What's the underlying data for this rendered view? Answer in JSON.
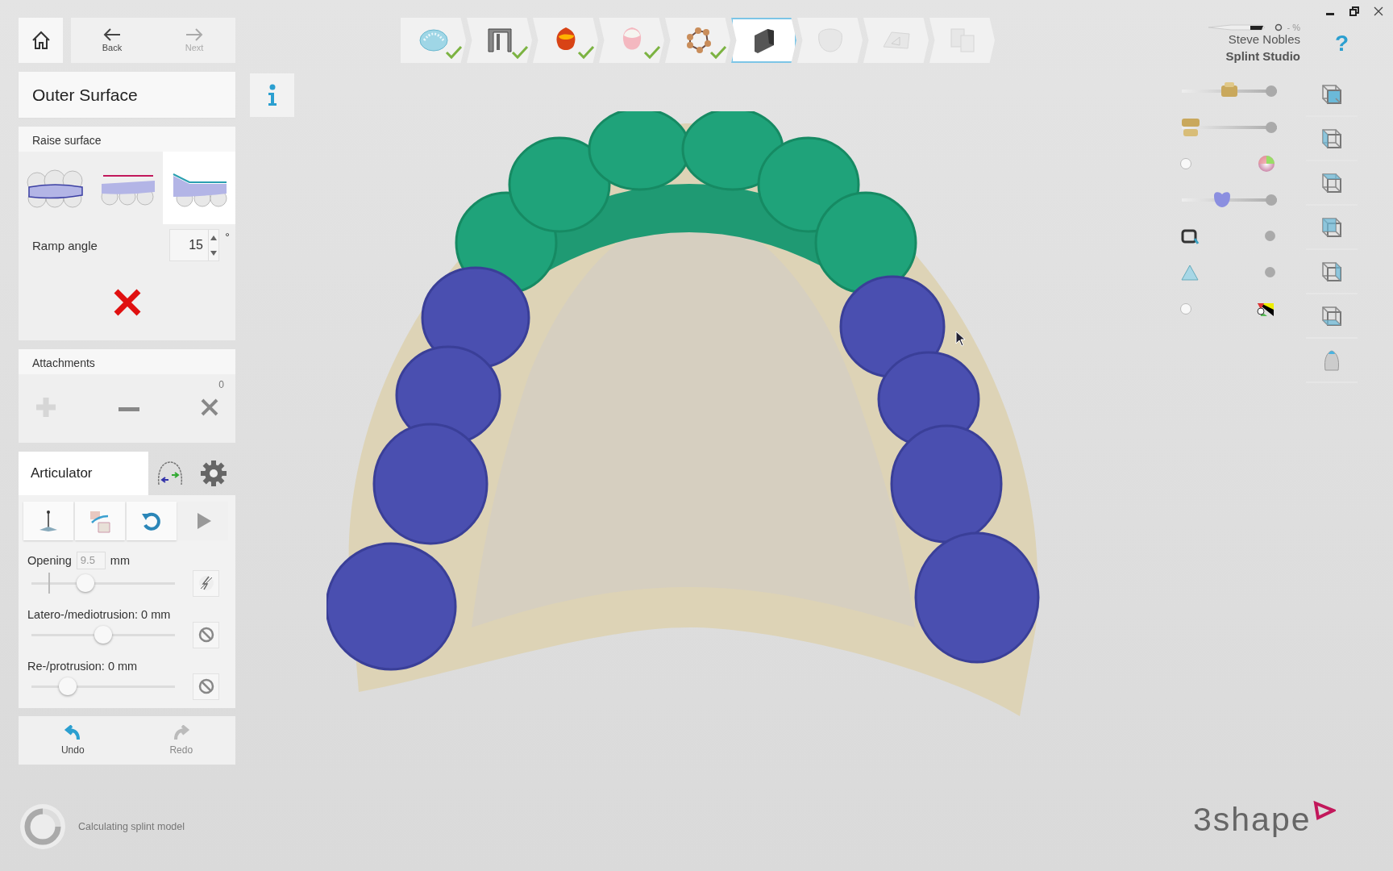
{
  "nav": {
    "back": {
      "label": "Back",
      "disabled": false
    },
    "next": {
      "label": "Next",
      "disabled": true
    }
  },
  "workflow_steps": [
    {
      "kind": "arch",
      "done": true,
      "selected": false,
      "disabled": false
    },
    {
      "kind": "frame",
      "done": true,
      "selected": false,
      "disabled": false
    },
    {
      "kind": "drop",
      "done": true,
      "selected": false,
      "disabled": false
    },
    {
      "kind": "gum",
      "done": true,
      "selected": false,
      "disabled": false
    },
    {
      "kind": "network",
      "done": true,
      "selected": false,
      "disabled": false
    },
    {
      "kind": "block",
      "done": false,
      "selected": true,
      "disabled": false
    },
    {
      "kind": "tooth",
      "done": false,
      "selected": false,
      "disabled": true
    },
    {
      "kind": "plane",
      "done": false,
      "selected": false,
      "disabled": true
    },
    {
      "kind": "devices",
      "done": false,
      "selected": false,
      "disabled": true
    }
  ],
  "panel_title": "Outer Surface",
  "raise_surface": {
    "title": "Raise surface",
    "options": [
      {
        "kind": "follow",
        "selected": false
      },
      {
        "kind": "flat",
        "selected": false
      },
      {
        "kind": "ramp",
        "selected": true
      }
    ]
  },
  "ramp_angle": {
    "label": "Ramp angle",
    "value": "15",
    "unit": "°"
  },
  "attachments": {
    "title": "Attachments",
    "count": "0"
  },
  "articulator": {
    "title": "Articulator",
    "tools": [
      {
        "kind": "pin",
        "disabled": false
      },
      {
        "kind": "move",
        "disabled": false
      },
      {
        "kind": "rotate",
        "disabled": false
      },
      {
        "kind": "play",
        "disabled": true
      }
    ],
    "opening": {
      "label": "Opening",
      "value": "9.5",
      "unit": "mm",
      "level": 0.36
    },
    "sliders": [
      {
        "label": "Latero-/mediotrusion: 0 mm",
        "level": 0.5
      },
      {
        "label": "Re-/protrusion: 0 mm",
        "level": 0.22
      }
    ]
  },
  "history": [
    {
      "kind": "undo",
      "label": "Undo",
      "disabled": false
    },
    {
      "kind": "redo",
      "label": "Redo",
      "disabled": true
    }
  ],
  "status": "Calculating splint model",
  "user": {
    "progress": "- %",
    "name": "Steve Nobles",
    "product": "Splint Studio"
  },
  "help": "?",
  "visibility": [
    {
      "kind": "slider",
      "level": 0.5
    },
    {
      "kind": "slider",
      "level": 0
    },
    {
      "kind": "toggle"
    },
    {
      "kind": "slider",
      "level": 0.4
    },
    {
      "kind": "toggle"
    },
    {
      "kind": "toggle"
    },
    {
      "kind": "toggle"
    }
  ],
  "logo": "3shape"
}
